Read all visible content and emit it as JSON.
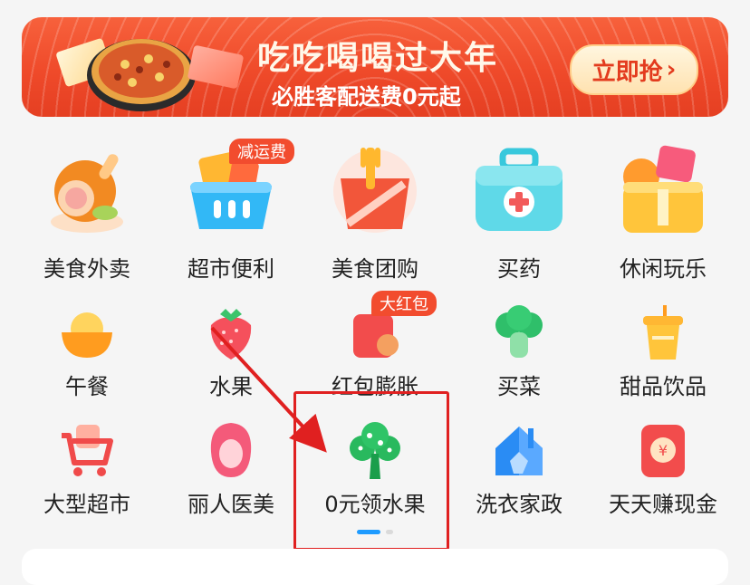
{
  "banner": {
    "title": "吃吃喝喝过大年",
    "subtitle": "必胜客配送费0元起",
    "cta_label": "立即抢",
    "cta_chevron": "›"
  },
  "grid": {
    "row1": [
      {
        "label": "美食外卖",
        "icon": "roast-chicken-icon"
      },
      {
        "label": "超市便利",
        "icon": "shopping-basket-icon",
        "badge": "减运费"
      },
      {
        "label": "美食团购",
        "icon": "fork-food-box-icon"
      },
      {
        "label": "买药",
        "icon": "medical-kit-icon"
      },
      {
        "label": "休闲玩乐",
        "icon": "leisure-basket-icon"
      }
    ],
    "row2": [
      {
        "label": "午餐",
        "icon": "rice-bowl-icon"
      },
      {
        "label": "水果",
        "icon": "strawberry-icon"
      },
      {
        "label": "红包膨胀",
        "icon": "red-packet-icon",
        "badge": "大红包"
      },
      {
        "label": "买菜",
        "icon": "broccoli-icon"
      },
      {
        "label": "甜品饮品",
        "icon": "drink-cup-icon"
      }
    ],
    "row3": [
      {
        "label": "大型超市",
        "icon": "shopping-cart-icon"
      },
      {
        "label": "丽人医美",
        "icon": "beauty-face-icon"
      },
      {
        "label": "0元领水果",
        "icon": "tree-icon"
      },
      {
        "label": "洗衣家政",
        "icon": "house-broom-icon"
      },
      {
        "label": "天天赚现金",
        "icon": "cash-envelope-icon"
      }
    ]
  },
  "colors": {
    "banner": "#ef4a2a",
    "accent_red": "#e02020",
    "page_dot_active": "#1e9bff"
  },
  "pager": {
    "pages": 2,
    "active": 1
  }
}
